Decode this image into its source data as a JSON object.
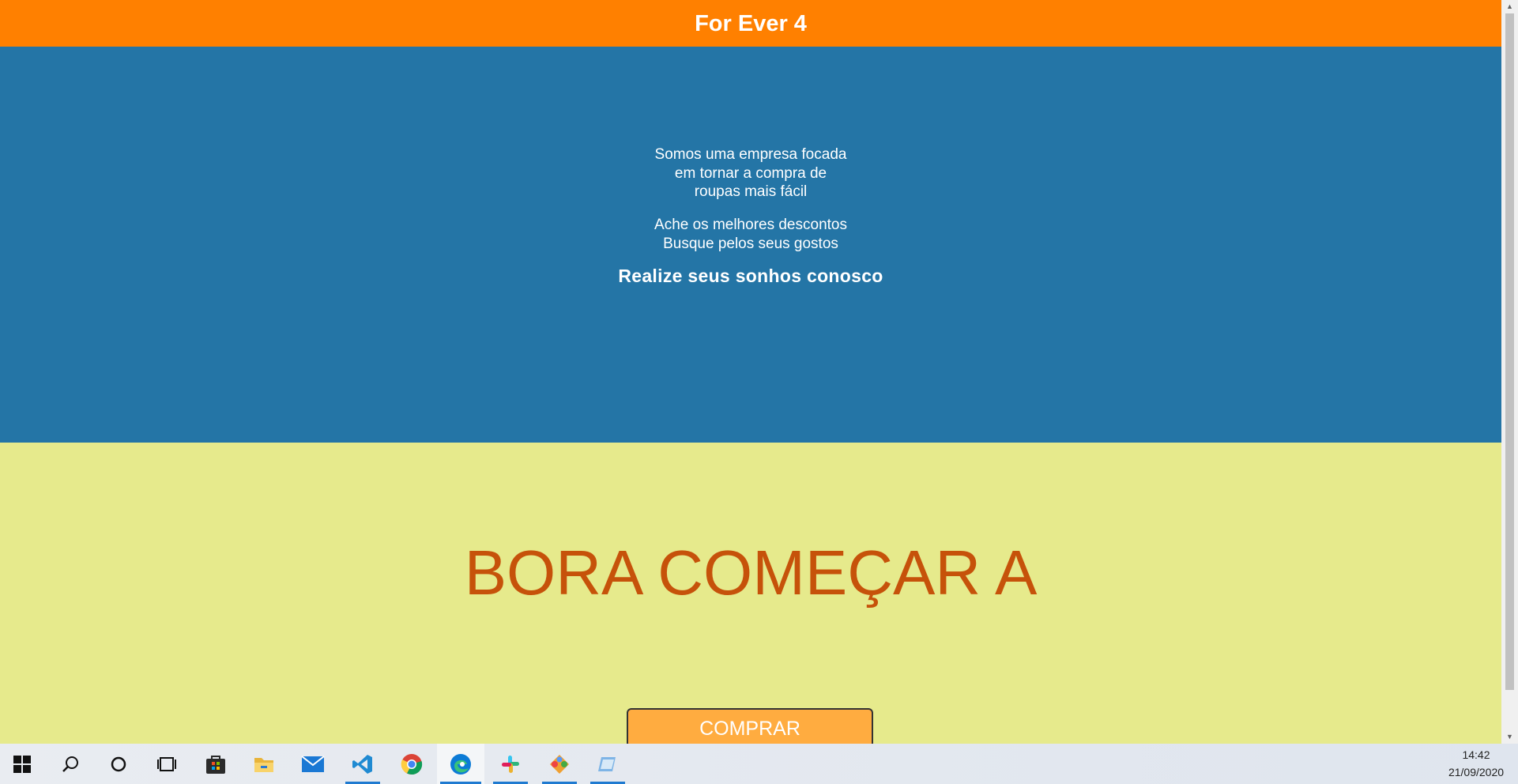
{
  "header": {
    "title": "For Ever 4",
    "color": "#ff8000"
  },
  "hero": {
    "background": "#2475a6",
    "paragraph1": [
      "Somos uma empresa focada",
      "em tornar a compra de",
      "roupas mais fácil"
    ],
    "paragraph2": [
      "Ache os melhores descontos",
      "Busque pelos seus gostos"
    ],
    "tagline": "Realize seus sonhos conosco"
  },
  "cta": {
    "background": "#e6ea8c",
    "headline": "BORA COMEÇAR A",
    "headline_color": "#c6520a",
    "button_label": "COMPRAR",
    "button_color": "#ffac40"
  },
  "taskbar": {
    "items": [
      {
        "icon": "windows-start-icon"
      },
      {
        "icon": "search-icon"
      },
      {
        "icon": "cortana-icon"
      },
      {
        "icon": "task-view-icon"
      },
      {
        "icon": "microsoft-store-icon"
      },
      {
        "icon": "file-explorer-icon"
      },
      {
        "icon": "mail-icon"
      },
      {
        "icon": "vscode-icon"
      },
      {
        "icon": "chrome-icon"
      },
      {
        "icon": "edge-icon"
      },
      {
        "icon": "slack-icon"
      },
      {
        "icon": "git-client-icon"
      },
      {
        "icon": "notepad-icon"
      }
    ],
    "time": "14:42",
    "date": "21/09/2020"
  }
}
